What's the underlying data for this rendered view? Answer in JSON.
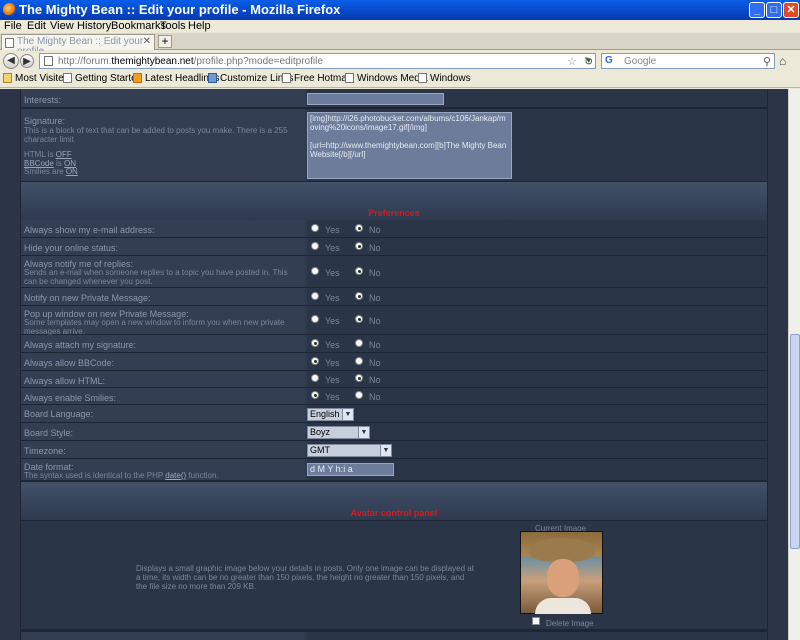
{
  "window": {
    "title": "The Mighty Bean :: Edit your profile - Mozilla Firefox"
  },
  "menu": [
    "File",
    "Edit",
    "View",
    "History",
    "Bookmarks",
    "Tools",
    "Help"
  ],
  "tab": {
    "label": "The Mighty Bean :: Edit your profile"
  },
  "nav": {
    "url_prefix": "http://forum.",
    "url_domain": "themightybean.net",
    "url_rest": "/profile.php?mode=editprofile",
    "search_placeholder": "Google"
  },
  "bookmarks": [
    "Most Visited",
    "Getting Started",
    "Latest Headlines",
    "Customize Links",
    "Free Hotmail",
    "Windows Media",
    "Windows"
  ],
  "profile": {
    "interests_label": "Interests:",
    "signature_label": "Signature:",
    "signature_help": "This is a block of text that can be added to posts you make. There is a 255 character limit",
    "html_is": "HTML is",
    "html_state": "OFF",
    "bbcode_link": "BBCode",
    "bbcode_is": "is",
    "bbcode_state": "ON",
    "smilies_are": "Smilies are",
    "smilies_state": "ON",
    "signature_value": "[img]http://i26.photobucket.com/albums/c106/Jankap/moving%20icons/image17.gif[/img]\n\n[url=http://www.themightybean.com][b]The Mighty Bean Website[/b][/url]"
  },
  "preferences": {
    "header": "Preferences",
    "yes": "Yes",
    "no": "No",
    "items": [
      {
        "label": "Always show my e-mail address:",
        "sub": "",
        "value": "No"
      },
      {
        "label": "Hide your online status:",
        "sub": "",
        "value": "No"
      },
      {
        "label": "Always notify me of replies:",
        "sub": "Sends an e-mail when someone replies to a topic you have posted in. This can be changed whenever you post.",
        "value": "No"
      },
      {
        "label": "Notify on new Private Message:",
        "sub": "",
        "value": "No"
      },
      {
        "label": "Pop up window on new Private Message:",
        "sub": "Some templates may open a new window to inform you when new private messages arrive.",
        "value": "No"
      },
      {
        "label": "Always attach my signature:",
        "sub": "",
        "value": "Yes"
      },
      {
        "label": "Always allow BBCode:",
        "sub": "",
        "value": "Yes"
      },
      {
        "label": "Always allow HTML:",
        "sub": "",
        "value": "No"
      },
      {
        "label": "Always enable Smilies:",
        "sub": "",
        "value": "Yes"
      }
    ],
    "language_label": "Board Language:",
    "language_value": "English",
    "style_label": "Board Style:",
    "style_value": "Boyz",
    "timezone_label": "Timezone:",
    "timezone_value": "GMT",
    "dateformat_label": "Date format:",
    "dateformat_help_pre": "The syntax used is identical to the PHP",
    "dateformat_help_link": "date()",
    "dateformat_help_post": "function.",
    "dateformat_value": "d M Y h:i a"
  },
  "avatar": {
    "header": "Avatar control panel",
    "description": "Displays a small graphic image below your details in posts. Only one image can be displayed at a time, its width can be no greater than 150 pixels, the height no greater than 150 pixels, and the file size no more than 209 KB.",
    "current_image_label": "Current Image",
    "delete_label": "Delete Image"
  }
}
